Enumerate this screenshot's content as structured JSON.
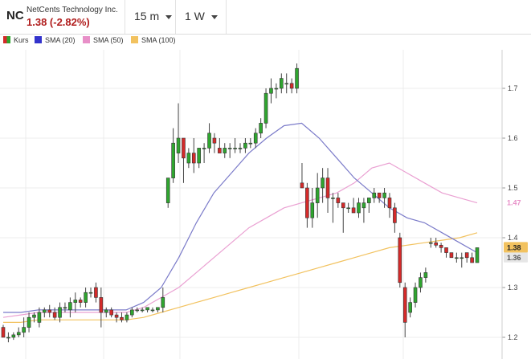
{
  "header": {
    "symbol": "NC",
    "company": "NetCents Technology Inc.",
    "price_change": "1.38 (-2.82%)",
    "interval": "15 m",
    "range": "1 W"
  },
  "legend": {
    "items": [
      {
        "label": "Kurs",
        "color": "#2fa52f"
      },
      {
        "label": "SMA (20)",
        "color": "#3333cc"
      },
      {
        "label": "SMA (50)",
        "color": "#e88fc8"
      },
      {
        "label": "SMA (100)",
        "color": "#f2c25f"
      }
    ]
  },
  "price_labels": {
    "sma50": "1.47",
    "last": "1.38",
    "sma20": "1.36"
  },
  "chart_data": {
    "type": "candlestick",
    "y_ticks": [
      "1.7",
      "1.6",
      "1.5",
      "1.4",
      "1.3",
      "1.2"
    ],
    "y_tick_values": [
      1.7,
      1.6,
      1.5,
      1.4,
      1.3,
      1.2
    ],
    "ylim": [
      1.18,
      1.81
    ],
    "grid": true,
    "candles": [
      [
        1.22,
        1.225,
        1.2,
        1.2
      ],
      [
        1.2,
        1.21,
        1.19,
        1.2
      ],
      [
        1.2,
        1.21,
        1.195,
        1.205
      ],
      [
        1.205,
        1.22,
        1.2,
        1.21
      ],
      [
        1.21,
        1.24,
        1.2,
        1.22
      ],
      [
        1.22,
        1.25,
        1.21,
        1.24
      ],
      [
        1.24,
        1.25,
        1.23,
        1.245
      ],
      [
        1.23,
        1.26,
        1.22,
        1.25
      ],
      [
        1.25,
        1.26,
        1.24,
        1.255
      ],
      [
        1.255,
        1.265,
        1.24,
        1.25
      ],
      [
        1.25,
        1.26,
        1.235,
        1.24
      ],
      [
        1.24,
        1.27,
        1.23,
        1.26
      ],
      [
        1.26,
        1.27,
        1.25,
        1.26
      ],
      [
        1.255,
        1.28,
        1.24,
        1.27
      ],
      [
        1.27,
        1.29,
        1.25,
        1.275
      ],
      [
        1.275,
        1.28,
        1.26,
        1.27
      ],
      [
        1.27,
        1.3,
        1.26,
        1.29
      ],
      [
        1.29,
        1.3,
        1.28,
        1.29
      ],
      [
        1.3,
        1.31,
        1.27,
        1.28
      ],
      [
        1.28,
        1.3,
        1.22,
        1.25
      ],
      [
        1.25,
        1.26,
        1.24,
        1.255
      ],
      [
        1.255,
        1.26,
        1.24,
        1.245
      ],
      [
        1.245,
        1.25,
        1.23,
        1.24
      ],
      [
        1.24,
        1.25,
        1.23,
        1.235
      ],
      [
        1.235,
        1.25,
        1.23,
        1.245
      ],
      [
        1.245,
        1.26,
        1.24,
        1.255
      ],
      [
        1.255,
        1.26,
        1.25,
        1.255
      ],
      [
        1.255,
        1.26,
        1.25,
        1.255
      ],
      [
        1.255,
        1.26,
        1.25,
        1.26
      ],
      [
        1.255,
        1.26,
        1.25,
        1.255
      ],
      [
        1.255,
        1.26,
        1.25,
        1.26
      ],
      [
        1.26,
        1.3,
        1.25,
        1.28
      ],
      [
        1.47,
        1.52,
        1.46,
        1.52
      ],
      [
        1.52,
        1.62,
        1.51,
        1.59
      ],
      [
        1.57,
        1.67,
        1.55,
        1.6
      ],
      [
        1.6,
        1.59,
        1.51,
        1.56
      ],
      [
        1.55,
        1.58,
        1.54,
        1.57
      ],
      [
        1.57,
        1.6,
        1.53,
        1.55
      ],
      [
        1.55,
        1.58,
        1.54,
        1.58
      ],
      [
        1.58,
        1.59,
        1.55,
        1.58
      ],
      [
        1.58,
        1.63,
        1.57,
        1.61
      ],
      [
        1.6,
        1.61,
        1.57,
        1.59
      ],
      [
        1.58,
        1.6,
        1.57,
        1.57
      ],
      [
        1.57,
        1.59,
        1.56,
        1.58
      ],
      [
        1.58,
        1.59,
        1.56,
        1.58
      ],
      [
        1.58,
        1.6,
        1.57,
        1.58
      ],
      [
        1.58,
        1.59,
        1.57,
        1.58
      ],
      [
        1.58,
        1.6,
        1.57,
        1.59
      ],
      [
        1.59,
        1.6,
        1.58,
        1.59
      ],
      [
        1.59,
        1.62,
        1.58,
        1.61
      ],
      [
        1.61,
        1.64,
        1.6,
        1.63
      ],
      [
        1.63,
        1.7,
        1.62,
        1.69
      ],
      [
        1.69,
        1.72,
        1.67,
        1.7
      ],
      [
        1.7,
        1.71,
        1.68,
        1.7
      ],
      [
        1.7,
        1.73,
        1.69,
        1.72
      ],
      [
        1.71,
        1.73,
        1.69,
        1.71
      ],
      [
        1.71,
        1.72,
        1.69,
        1.7
      ],
      [
        1.7,
        1.75,
        1.69,
        1.74
      ],
      [
        1.51,
        1.55,
        1.5,
        1.5
      ],
      [
        1.5,
        1.51,
        1.42,
        1.44
      ],
      [
        1.44,
        1.5,
        1.42,
        1.47
      ],
      [
        1.47,
        1.53,
        1.44,
        1.5
      ],
      [
        1.5,
        1.54,
        1.47,
        1.52
      ],
      [
        1.52,
        1.54,
        1.45,
        1.48
      ],
      [
        1.48,
        1.49,
        1.43,
        1.48
      ],
      [
        1.48,
        1.49,
        1.46,
        1.47
      ],
      [
        1.47,
        1.47,
        1.41,
        1.46
      ],
      [
        1.46,
        1.47,
        1.45,
        1.46
      ],
      [
        1.46,
        1.48,
        1.45,
        1.45
      ],
      [
        1.45,
        1.48,
        1.44,
        1.47
      ],
      [
        1.46,
        1.48,
        1.43,
        1.47
      ],
      [
        1.47,
        1.48,
        1.45,
        1.48
      ],
      [
        1.48,
        1.5,
        1.47,
        1.49
      ],
      [
        1.49,
        1.49,
        1.47,
        1.48
      ],
      [
        1.48,
        1.5,
        1.46,
        1.49
      ],
      [
        1.48,
        1.49,
        1.44,
        1.46
      ],
      [
        1.46,
        1.47,
        1.41,
        1.43
      ],
      [
        1.4,
        1.41,
        1.3,
        1.31
      ],
      [
        1.3,
        1.31,
        1.2,
        1.23
      ],
      [
        1.25,
        1.28,
        1.24,
        1.27
      ],
      [
        1.27,
        1.31,
        1.26,
        1.3
      ],
      [
        1.3,
        1.33,
        1.29,
        1.32
      ],
      [
        1.32,
        1.34,
        1.31,
        1.33
      ],
      [
        1.39,
        1.4,
        1.38,
        1.39
      ],
      [
        1.39,
        1.4,
        1.38,
        1.385
      ],
      [
        1.385,
        1.39,
        1.37,
        1.38
      ],
      [
        1.38,
        1.38,
        1.36,
        1.37
      ],
      [
        1.37,
        1.37,
        1.36,
        1.36
      ],
      [
        1.36,
        1.37,
        1.35,
        1.36
      ],
      [
        1.36,
        1.37,
        1.34,
        1.36
      ],
      [
        1.37,
        1.37,
        1.35,
        1.36
      ],
      [
        1.36,
        1.37,
        1.35,
        1.35
      ],
      [
        1.35,
        1.38,
        1.35,
        1.38
      ]
    ],
    "sma20": [
      1.25,
      1.25,
      1.255,
      1.255,
      1.255,
      1.255,
      1.255,
      1.255,
      1.27,
      1.3,
      1.36,
      1.43,
      1.49,
      1.53,
      1.57,
      1.6,
      1.625,
      1.63,
      1.6,
      1.56,
      1.52,
      1.49,
      1.46,
      1.44,
      1.43,
      1.41,
      1.39,
      1.37
    ],
    "sma50": [
      1.24,
      1.245,
      1.25,
      1.25,
      1.25,
      1.25,
      1.25,
      1.25,
      1.26,
      1.28,
      1.3,
      1.33,
      1.36,
      1.39,
      1.42,
      1.44,
      1.46,
      1.47,
      1.48,
      1.49,
      1.51,
      1.54,
      1.55,
      1.53,
      1.51,
      1.49,
      1.48,
      1.47
    ],
    "sma100": [
      1.23,
      1.23,
      1.235,
      1.235,
      1.235,
      1.235,
      1.235,
      1.235,
      1.24,
      1.25,
      1.26,
      1.27,
      1.28,
      1.29,
      1.3,
      1.31,
      1.32,
      1.33,
      1.34,
      1.35,
      1.36,
      1.37,
      1.38,
      1.385,
      1.39,
      1.395,
      1.4,
      1.41
    ]
  }
}
